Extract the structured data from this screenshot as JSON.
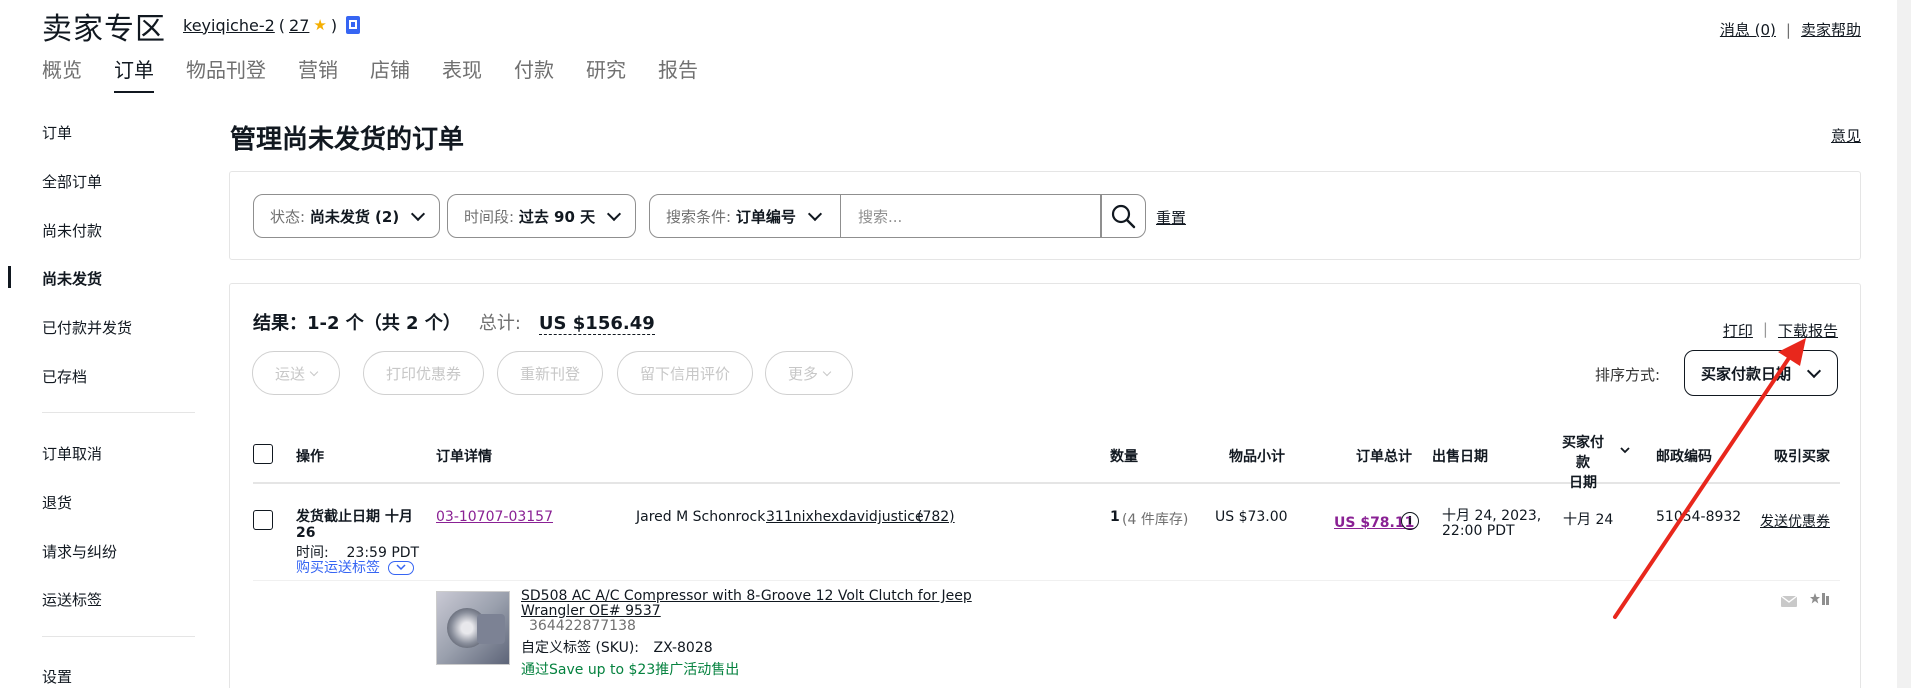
{
  "header": {
    "brand": "卖家专区",
    "seller_name": "keyiqiche-2",
    "feedback_open": "(",
    "feedback_score": "27",
    "feedback_close": ")",
    "star": "★",
    "messages": "消息 (0)",
    "help": "卖家帮助"
  },
  "tabs": [
    "概览",
    "订单",
    "物品刊登",
    "营销",
    "店铺",
    "表现",
    "付款",
    "研究",
    "报告"
  ],
  "sidebar": {
    "items": [
      "订单",
      "全部订单",
      "尚未付款",
      "尚未发货",
      "已付款并发货",
      "已存档",
      "订单取消",
      "退货",
      "请求与纠纷",
      "运送标签",
      "设置"
    ]
  },
  "main": {
    "title": "管理尚未发货的订单",
    "feedback_link": "意见"
  },
  "filters": {
    "status_label": "状态: ",
    "status_value": "尚未发货 (2)",
    "period_label": "时间段: ",
    "period_value": "过去 90 天",
    "criteria_label": "搜索条件: ",
    "criteria_value": "订单编号",
    "search_placeholder": "搜索...",
    "reset": "重置"
  },
  "results": {
    "label": "结果：1-2 个（共 2 个）",
    "total_label": "总计:",
    "total_value": "US $156.49",
    "print": "打印",
    "sep": "|",
    "download": "下载报告"
  },
  "actions": [
    "运送",
    "打印优惠券",
    "重新刊登",
    "留下信用评价",
    "更多"
  ],
  "sort": {
    "label": "排序方式:",
    "value": "买家付款日期"
  },
  "table": {
    "headers": {
      "action": "操作",
      "details": "订单详情",
      "qty": "数量",
      "subtotal": "物品小计",
      "total": "订单总计",
      "sale_date": "出售日期",
      "paid_date_1": "买家付款",
      "paid_date_2": "日期",
      "zip": "邮政编码",
      "attract": "吸引买家"
    },
    "row": {
      "deadline_1": "发货截止日期 十月",
      "deadline_2": "26",
      "deadline_time": "时间:    23:59 PDT",
      "buy_label": "购买运送标签",
      "order_no": "03-10707-03157",
      "buyer_name": "Jared M Schonrock",
      "buyer_id": "311nixhexdavidjustice",
      "buyer_fb": "(782)",
      "qty": "1",
      "stock": "(4 件库存)",
      "subtotal": "US $73.00",
      "total": "US $78.11",
      "sale_date_1": "十月 24, 2023,",
      "sale_date_2": "22:00 PDT",
      "paid_date": "十月 24",
      "zip": "51054-8932",
      "coupon": "发送优惠券"
    },
    "item": {
      "title_1": "SD508 AC A/C Compressor with 8-Groove 12 Volt Clutch for Jeep",
      "title_2": "Wrangler OE# 9537",
      "item_no": "364422877138",
      "sku_label": "自定义标签 (SKU):",
      "sku": "ZX-8028",
      "promo": "通过Save up to $23推广活动售出"
    }
  },
  "colors": {
    "accent_purple": "#8a2194",
    "link_blue": "#3665f3",
    "promo_green": "#05823f",
    "arrow_red": "#e8271c"
  }
}
